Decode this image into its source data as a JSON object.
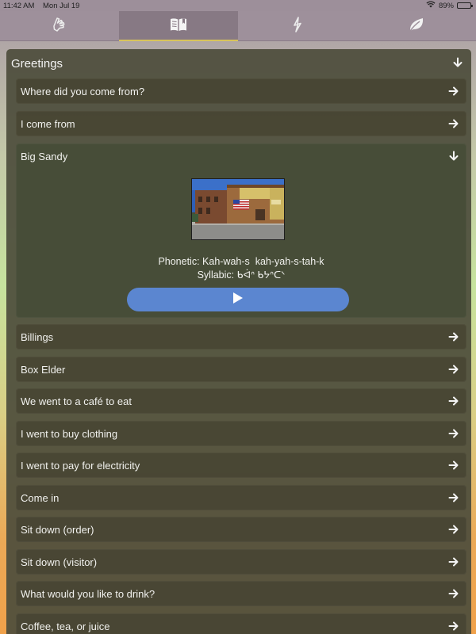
{
  "status_bar": {
    "time": "11:42 AM",
    "date": "Mon Jul 19",
    "battery": "89%",
    "battery_level": 0.89
  },
  "tabs": [
    {
      "icon": "hand-sign-icon",
      "active": false
    },
    {
      "icon": "open-book-icon",
      "active": true
    },
    {
      "icon": "lightning-icon",
      "active": false
    },
    {
      "icon": "leaf-icon",
      "active": false
    }
  ],
  "section": {
    "title": "Greetings",
    "items": [
      {
        "label": "Where did you come from?"
      },
      {
        "label": "I come from"
      },
      {
        "label": "Big Sandy",
        "expanded": true,
        "phonetic": "Phonetic: Kah-wah-s  kah-yah-s-tah-k",
        "syllabic": "Syllabic: ᑲᐋᐢ ᑲᔭᐢᑕᐠ"
      },
      {
        "label": "Billings"
      },
      {
        "label": "Box Elder"
      },
      {
        "label": "We went to a café to eat"
      },
      {
        "label": "I went to buy clothing"
      },
      {
        "label": "I went to pay for electricity"
      },
      {
        "label": "Come in"
      },
      {
        "label": "Sit down (order)"
      },
      {
        "label": "Sit down (visitor)"
      },
      {
        "label": "What would you like to drink?"
      },
      {
        "label": "Coffee, tea, or juice"
      }
    ]
  },
  "colors": {
    "accent": "#d8c35a",
    "play_button": "#5b86d0",
    "tab_bar": "#9e909b"
  }
}
